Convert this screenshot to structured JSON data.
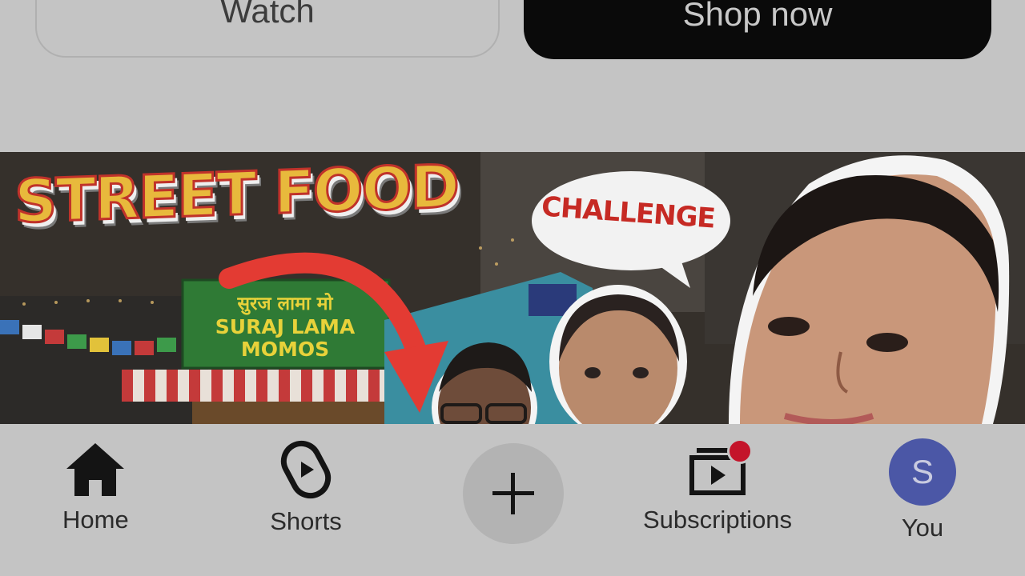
{
  "top_buttons": {
    "watch_label": "Watch",
    "shop_label": "Shop now"
  },
  "thumbnail": {
    "title": "STREET FOOD",
    "bubble": "CHALLENGE",
    "sign_hindi": "सुरज लामा मो",
    "sign_line1": "SURAJ LAMA",
    "sign_line2": "MOMOS"
  },
  "bottom_nav": {
    "items": [
      {
        "label": "Home",
        "icon": "home-icon"
      },
      {
        "label": "Shorts",
        "icon": "shorts-icon"
      },
      {
        "label": "",
        "icon": "plus-icon"
      },
      {
        "label": "Subscriptions",
        "icon": "subscriptions-icon"
      },
      {
        "label": "You",
        "icon": "avatar"
      }
    ],
    "avatar_letter": "S"
  },
  "colors": {
    "background": "#c4c4c4",
    "shop_button": "#0a0a0a",
    "avatar": "#4b57a6",
    "notification_dot": "#c4142a",
    "arrow": "#e33b33"
  }
}
